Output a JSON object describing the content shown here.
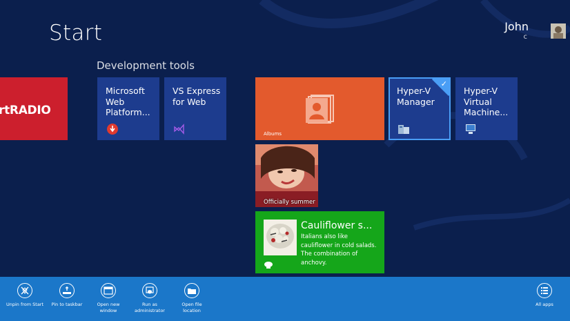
{
  "screen": {
    "title": "Start"
  },
  "user": {
    "name": "John",
    "sub": "c"
  },
  "group": {
    "title": "Development tools"
  },
  "tiles": {
    "radio": {
      "label": "rtRADIO"
    },
    "web_platform": {
      "label": "Microsoft\nWeb\nPlatform..."
    },
    "vs_express": {
      "label": "VS Express\nfor Web"
    },
    "albums": {
      "label": "Albums"
    },
    "hyperv_manager": {
      "label": "Hyper-V\nManager"
    },
    "hyperv_vm": {
      "label": "Hyper-V\nVirtual\nMachine..."
    },
    "photo": {
      "label": "Officially summer"
    },
    "food": {
      "title": "Cauliflower s...",
      "body": "Italians also like cauliflower in cold salads. The combination of anchovy."
    }
  },
  "appbar": {
    "unpin": "Unpin from Start",
    "pin_taskbar": "Pin to taskbar",
    "open_new_window": "Open new\nwindow",
    "run_admin": "Run as\nadministrator",
    "open_location": "Open file\nlocation",
    "all_apps": "All apps"
  },
  "colors": {
    "background": "#0b1f4d",
    "tile_blue": "#1d3c8e",
    "albums": "#e35a2d",
    "food": "#15a61a",
    "radio": "#cc1f2d",
    "appbar": "#1b77c9",
    "selection": "#4a9ef5"
  }
}
